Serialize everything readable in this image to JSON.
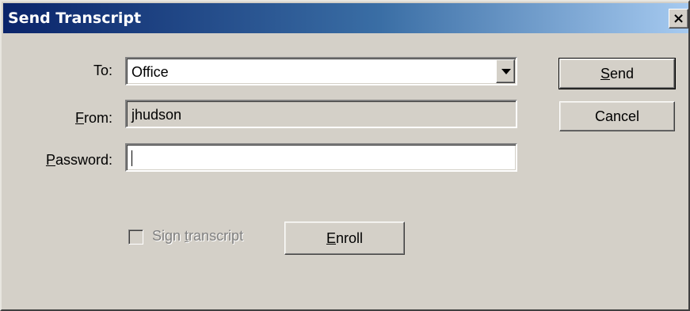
{
  "window": {
    "title": "Send Transcript",
    "close_label": "×"
  },
  "form": {
    "to": {
      "label_prefix": "",
      "label_mnemonic": "",
      "label_rest": "To:",
      "value": "Office"
    },
    "from": {
      "label_mnemonic": "F",
      "label_rest": "rom:",
      "value": "jhudson"
    },
    "password": {
      "label_mnemonic": "P",
      "label_rest": "assword:",
      "value": ""
    },
    "sign_transcript": {
      "label_prefix": "Sign ",
      "label_mnemonic": "t",
      "label_rest": "ranscript",
      "checked": false,
      "enabled": false
    }
  },
  "buttons": {
    "send": {
      "mnemonic": "S",
      "rest": "end"
    },
    "cancel": {
      "label": "Cancel"
    },
    "enroll": {
      "mnemonic": "E",
      "rest": "nroll"
    }
  },
  "colors": {
    "dialog_bg": "#d4d0c8",
    "title_gradient_start": "#0a246a",
    "title_gradient_end": "#a6caf0",
    "disabled_text": "#808080"
  }
}
